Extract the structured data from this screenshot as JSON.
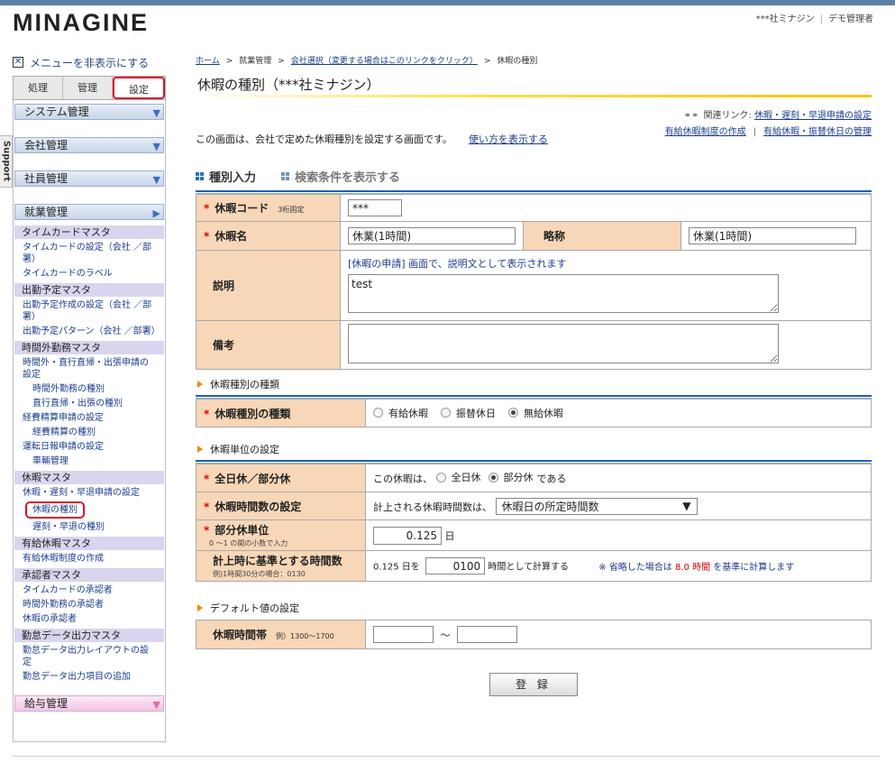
{
  "header": {
    "logo": "MINAGINE",
    "company": "***社ミナジン",
    "user": "デモ管理者"
  },
  "support_tab": "Support",
  "sidebar": {
    "hide_menu": "メニューを非表示にする",
    "tabs": [
      "処理",
      "管理",
      "設定"
    ],
    "groups_top": [
      "システム管理",
      "会社管理",
      "社員管理"
    ],
    "current_group": "就業管理",
    "categories": [
      {
        "title": "タイムカードマスタ",
        "links": [
          {
            "label": "タイムカードの設定（会社 ／部署）",
            "indent": false
          },
          {
            "label": "タイムカードのラベル",
            "indent": false
          }
        ]
      },
      {
        "title": "出勤予定マスタ",
        "links": [
          {
            "label": "出勤予定作成の設定（会社 ／部署）",
            "indent": false
          },
          {
            "label": "出勤予定パターン（会社 ／部署）",
            "indent": false
          }
        ]
      },
      {
        "title": "時間外勤務マスタ",
        "links": [
          {
            "label": "時間外・直行直帰・出張申請の設定",
            "indent": false
          },
          {
            "label": "時間外勤務の種別",
            "indent": true
          },
          {
            "label": "直行直帰・出張の種別",
            "indent": true
          },
          {
            "label": "経費精算申請の設定",
            "indent": false
          },
          {
            "label": "経費精算の種別",
            "indent": true
          },
          {
            "label": "運転日報申請の設定",
            "indent": false
          },
          {
            "label": "車輛管理",
            "indent": true
          }
        ]
      },
      {
        "title": "休暇マスタ",
        "links": [
          {
            "label": "休暇・遅刻・早退申請の設定",
            "indent": false
          },
          {
            "label": "休暇の種別",
            "indent": true,
            "circled": true
          },
          {
            "label": "遅刻・早退の種別",
            "indent": true
          }
        ]
      },
      {
        "title": "有給休暇マスタ",
        "links": [
          {
            "label": "有給休暇制度の作成",
            "indent": false
          }
        ]
      },
      {
        "title": "承認者マスタ",
        "links": [
          {
            "label": "タイムカードの承認者",
            "indent": false
          },
          {
            "label": "時間外勤務の承認者",
            "indent": false
          },
          {
            "label": "休暇の承認者",
            "indent": false
          }
        ]
      },
      {
        "title": "勤怠データ出力マスタ",
        "links": [
          {
            "label": "勤怠データ出力レイアウトの設定",
            "indent": false
          },
          {
            "label": "勤怠データ出力項目の追加",
            "indent": false
          }
        ]
      }
    ],
    "bottom_group": "給与管理"
  },
  "breadcrumb": {
    "home": "ホーム",
    "mid": "就業管理",
    "company_select": "会社選択（変更する場合はこのリンクをクリック）",
    "current": "休暇の種別"
  },
  "page_title": "休暇の種別（***社ミナジン）",
  "related": {
    "label": "関連リンク:",
    "link1": "休暇・遅刻・早退申請の設定",
    "link2": "有給休暇制度の作成",
    "link3": "有給休暇・振替休日の管理"
  },
  "description": {
    "text": "この画面は、会社で定めた休暇種別を設定する画面です。",
    "howto": "使い方を表示する"
  },
  "section_tabs": {
    "input": "種別入力",
    "search": "検索条件を表示する"
  },
  "form": {
    "code_label": "休暇コード",
    "code_note": "3桁固定",
    "code_value": "***",
    "name_label": "休暇名",
    "name_value": "休業(1時間)",
    "abbr_label": "略称",
    "abbr_value": "休業(1時間)",
    "desc_label": "説明",
    "desc_hint_bracket": "[休暇の申請]",
    "desc_hint_rest": " 画面で、説明文として表示されます",
    "desc_value": "test",
    "remarks_label": "備考",
    "remarks_value": ""
  },
  "kind_section": {
    "heading": "休暇種別の種類",
    "label": "休暇種別の種類",
    "options": [
      "有給休暇",
      "振替休日",
      "無給休暇"
    ],
    "selected": "無給休暇"
  },
  "unit_section": {
    "heading": "休暇単位の設定",
    "fullpart_label": "全日休／部分休",
    "fullpart_prefix": "この休暇は、",
    "fullpart_options": [
      "全日休",
      "部分休"
    ],
    "fullpart_selected": "部分休",
    "fullpart_suffix": "である",
    "hours_label": "休暇時間数の設定",
    "hours_prefix": "計上される休暇時間数は、",
    "hours_selected": "休暇日の所定時間数",
    "part_label": "部分休単位",
    "part_sub": "0 ～1 の間の小数で入力",
    "part_value": "0.125",
    "part_unit": "日",
    "base_label": "計上時に基準とする時間数",
    "base_sub": "例)1時間30分の場合：0130",
    "base_prefix": "0.125 日を",
    "base_value": "0100",
    "base_suffix": "時間として計算する",
    "base_note_a": "※ 省略した場合は",
    "base_note_b": "8.0 時間",
    "base_note_c": "を基準に計算します"
  },
  "default_section": {
    "heading": "デフォルト値の設定",
    "range_label": "休暇時間帯",
    "range_note": "例）1300～1700",
    "from": "",
    "tilde": "～",
    "to": ""
  },
  "submit_label": "登 録"
}
